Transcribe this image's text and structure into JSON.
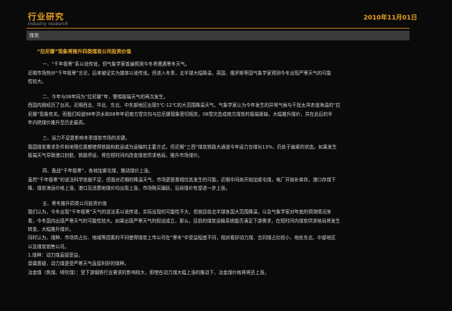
{
  "header": {
    "title": "行业研究",
    "subtitle": "Industry research",
    "date": "2010年11月01日"
  },
  "section": {
    "label": "煤炭"
  },
  "article": {
    "title": "“拉尼娜”现象将推升四类煤炭公司投资价值",
    "lines": [
      "一、“千年极寒”系以讹传讹，但气象学家普遍预测今冬将遭遇寒冬天气。",
      "近期市场热炒“千年极寒”言论，后来被证实为媒体以讹传讹。但进入冬季，北半球大幅降温，英国、俄罗斯等国气象学家预测今冬出现严寒天气的可能",
      "性较大。",
      "二、今年与08年同为“拉尼娜”年，警惕极端天气的再次发生。",
      "西国内刚经历了台风，近期西北、华北、东北、中东部地区出现5℃-12℃的大范围降温天气，气象学家认为今年发生的异常气候与干扰太洋赤道海温的“拉",
      "尼娜”现象有关。而我们知道98年洪水和08年年初南方雪灾均与拉尼娜现象密切相关，08雪灾造成南方煤炭的极端紧缺，大幅推升煤价，并在此后的半",
      "年内把煤价推升至历史最高。",
      "三、运力不足是影响冬季煤炭市场的关键。",
      "我国煤炭需求条件和地理位置都使得铁路和航运成为运输的主要方式，但近期“三西”煤炭铁路大通道今年运力仅增长13%，仍处于偏紧的状态。如果发生",
      "极端天气导致港口封航、铁路停运，将在短时间内改变煤炭供求格局，推升市场煤价。",
      "四、备战“千年极寒”，各地加紧屯煤，推动煤价上涨。",
      "虽然“千年极寒”的说法科学依据不足，但面对近期的降温天气，市场更愿意相信其发生的可能，近期中间商开始加紧屯煤，电厂开始补库存，港口存煤下",
      "降，煤炭海运价格上涨，港口及消费地煤价均出现上涨，市场购买踊跃，后续煤价有望进一步上涨。",
      "五、寒冬推升四类公司投资价值",
      "我们认为，今冬出现“千年极寒”天气的说法系以讹传讹，实际出现的可能性不大，但就目前北半球各国大范围降温，以及气象学家对年底的预测情况来",
      "看，今冬国内出现严寒天气的可能性较大。如果出现严寒天气的假设成立，那么，目前的煤炭运输系统能否满足下游需求，在短时间内煤炭供求格局将发生",
      "转变，大幅推升煤价。",
      "同时认为，煤种、市场供占比、地域等因素的不同使得煤炭上市公司在“寒冬”中受益程度不同，相对看好动力煤、合同煤占比较小、地处东北、中部地区",
      "以及煤炭销售公司。",
      "1.煤种：动力煤直接受益。",
      "毋庸置疑，动力煤是受严寒天气直接利好的煤种。",
      "冶金煤（焦煤、喷吹煤）：受下游钢铁行业需求的影响较大，即使在动力煤大幅上涨的推动下，冶金煤价格将将还上涨，"
    ]
  }
}
